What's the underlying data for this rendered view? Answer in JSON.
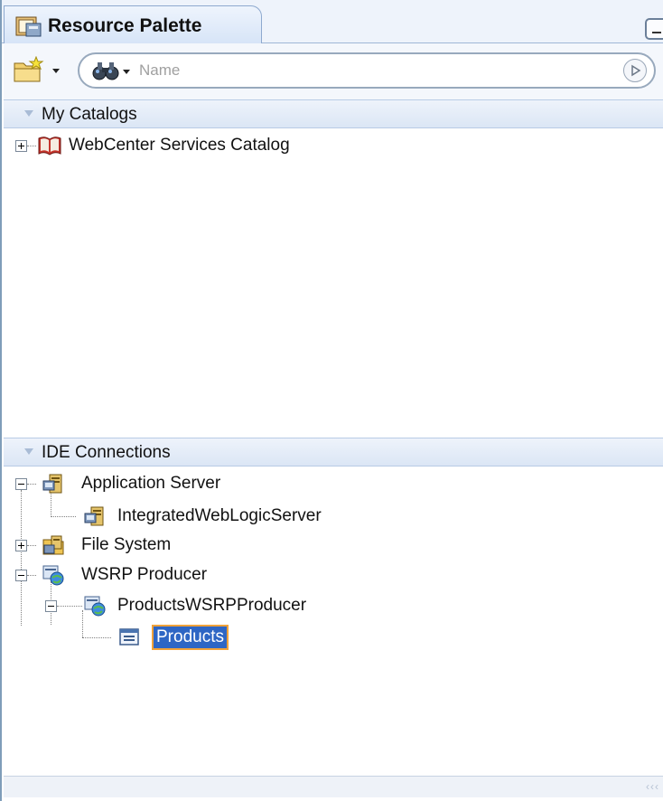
{
  "panel": {
    "tab_title": "Resource Palette",
    "minimize_icon": "minimize-icon"
  },
  "toolbar": {
    "new_icon": "new-folder-icon",
    "scope_icon": "binoculars-icon",
    "search_placeholder": "Name",
    "go_icon": "go-arrow-icon"
  },
  "catalogs": {
    "header": "My Catalogs",
    "items": [
      {
        "label": "WebCenter Services Catalog",
        "icon": "book-icon",
        "expanded": false
      }
    ]
  },
  "connections": {
    "header": "IDE Connections",
    "items": [
      {
        "label": "Application Server",
        "icon": "server-icon",
        "expanded": true,
        "depth": 0
      },
      {
        "label": "IntegratedWebLogicServer",
        "icon": "server-icon",
        "depth": 1
      },
      {
        "label": "File System",
        "icon": "folder-server-icon",
        "expanded": false,
        "depth": 0
      },
      {
        "label": "WSRP Producer",
        "icon": "wsrp-icon",
        "expanded": true,
        "depth": 0
      },
      {
        "label": "ProductsWSRPProducer",
        "icon": "wsrp-icon",
        "expanded": true,
        "depth": 1
      },
      {
        "label": "Products",
        "icon": "portlet-icon",
        "depth": 2,
        "selected": true
      }
    ]
  },
  "colors": {
    "selection": "#2e66c4",
    "selection_outline": "#f0a23a",
    "header_bg": "#dbe6f5"
  }
}
